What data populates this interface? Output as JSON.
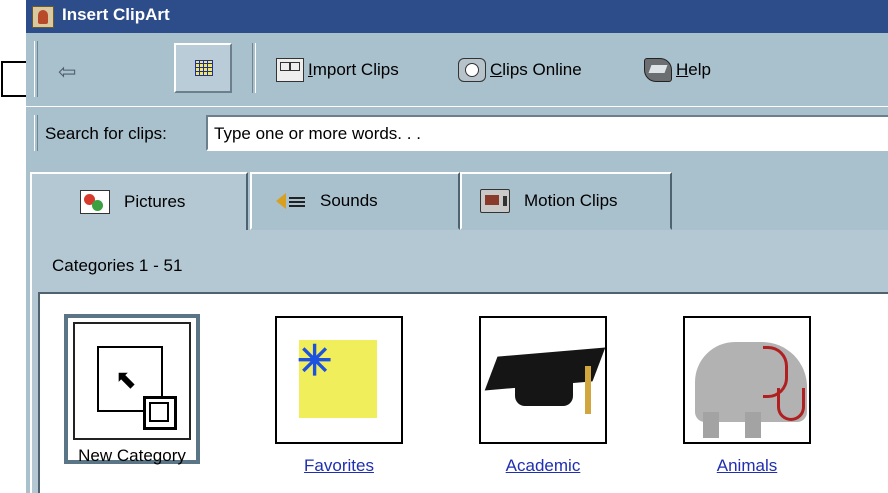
{
  "window": {
    "title": "Insert ClipArt"
  },
  "toolbar": {
    "import_label_u": "I",
    "import_label_rest": "mport Clips",
    "online_label_u": "C",
    "online_label_rest": "lips Online",
    "help_label_u": "H",
    "help_label_rest": "elp"
  },
  "search": {
    "label": "Search for clips:",
    "placeholder": "Type one or more words. . ."
  },
  "tabs": [
    {
      "label": "Pictures",
      "active": true
    },
    {
      "label": "Sounds",
      "active": false
    },
    {
      "label": "Motion Clips",
      "active": false
    }
  ],
  "panel": {
    "count": "Categories 1 - 51"
  },
  "categories": [
    {
      "label": "New Category",
      "selected": true
    },
    {
      "label": "Favorites"
    },
    {
      "label": "Academic"
    },
    {
      "label": "Animals"
    }
  ],
  "colors": {
    "titlebar": "#2c4d8a",
    "chrome": "#a9c0cd",
    "link": "#1f2fb0"
  }
}
